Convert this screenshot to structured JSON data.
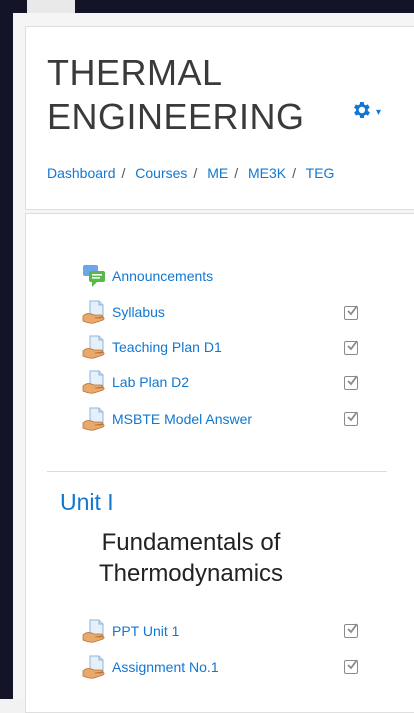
{
  "course": {
    "title": "THERMAL ENGINEERING"
  },
  "breadcrumb": [
    "Dashboard",
    "Courses",
    "ME",
    "ME3K",
    "TEG"
  ],
  "settings": {
    "icon": "gear-icon",
    "caret": "▾"
  },
  "activities_top": [
    {
      "label": "Announcements",
      "icon": "forum-icon",
      "completion": false
    },
    {
      "label": "Syllabus",
      "icon": "file-icon",
      "completion": true
    },
    {
      "label": "Teaching Plan D1",
      "icon": "file-icon",
      "completion": true
    },
    {
      "label": "Lab Plan D2",
      "icon": "file-icon",
      "completion": true
    },
    {
      "label": "MSBTE Model Answer",
      "icon": "file-icon",
      "completion": true
    }
  ],
  "unit1": {
    "title": "Unit I",
    "summary": "Fundamentals of Thermodynamics",
    "activities": [
      {
        "label": "PPT Unit 1",
        "icon": "file-icon",
        "completion": true
      },
      {
        "label": "Assignment No.1",
        "icon": "file-icon",
        "completion": true
      }
    ]
  },
  "colors": {
    "link": "#1177d1",
    "frame": "#141428"
  }
}
